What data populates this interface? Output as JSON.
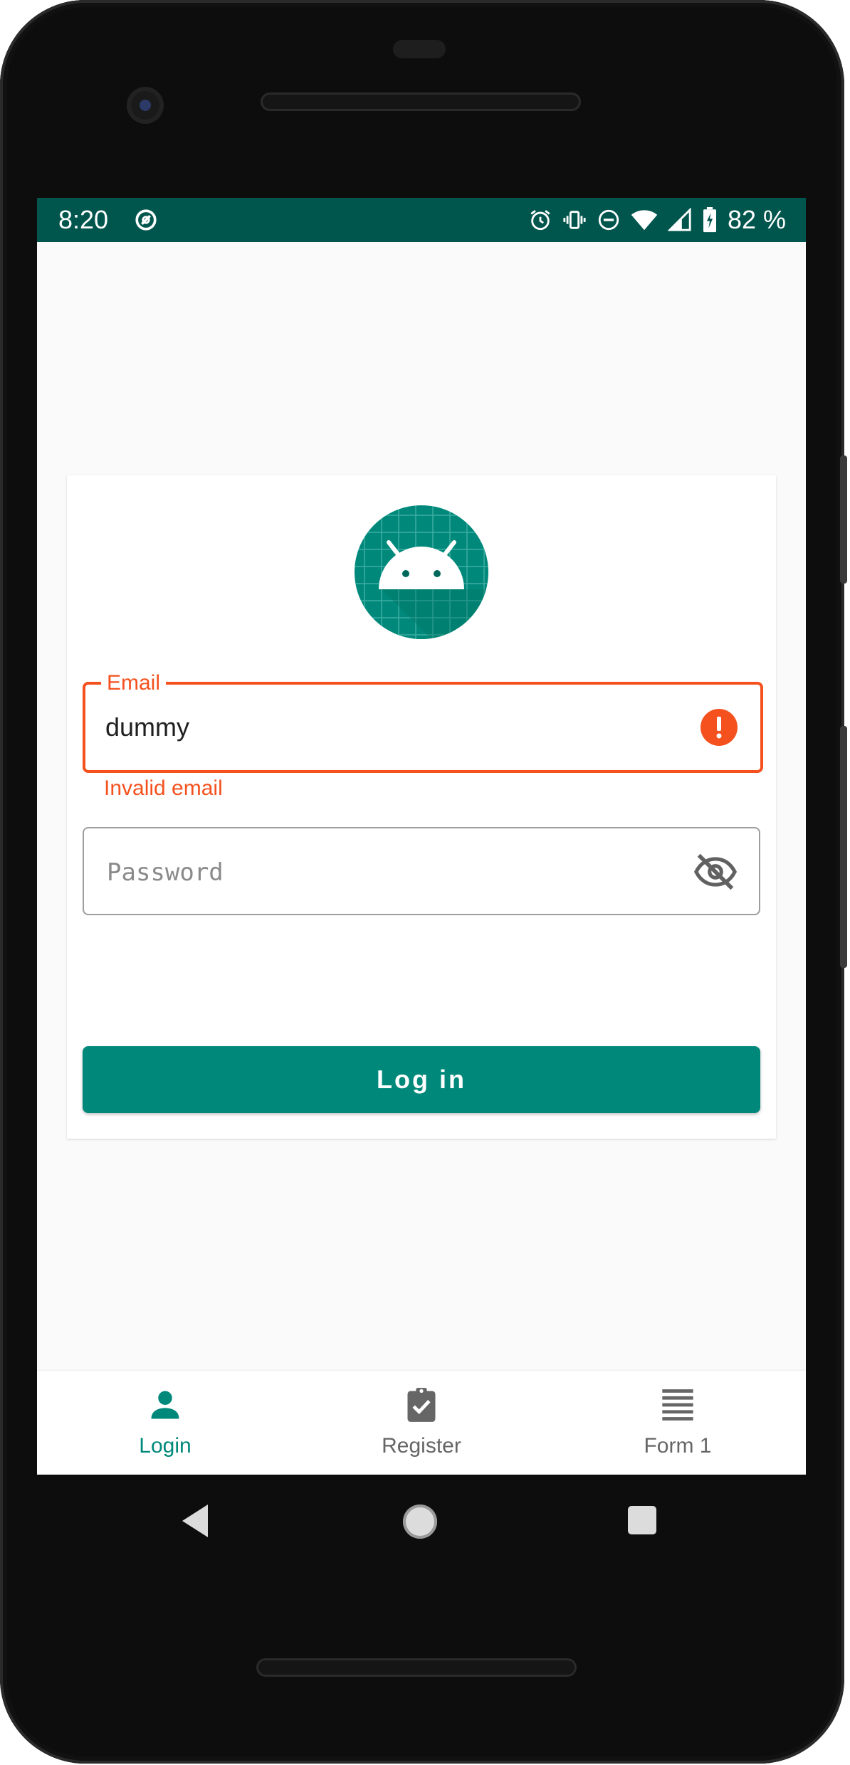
{
  "status_bar": {
    "time": "8:20",
    "battery_percent": "82 %",
    "icons": [
      "do-not-disturb-icon",
      "alarm-icon",
      "vibrate-icon",
      "dnd-icon",
      "wifi-icon",
      "signal-icon",
      "battery-charging-icon"
    ]
  },
  "login": {
    "logo_icon": "android-logo-icon",
    "email": {
      "label": "Email",
      "value": "dummy",
      "error": "Invalid email",
      "error_icon": "error-icon"
    },
    "password": {
      "placeholder": "Password",
      "toggle_icon": "visibility-off-icon"
    },
    "login_button": "Log in"
  },
  "bottom_nav": {
    "items": [
      {
        "label": "Login",
        "icon": "person-icon",
        "active": true
      },
      {
        "label": "Register",
        "icon": "clipboard-check-icon",
        "active": false
      },
      {
        "label": "Form 1",
        "icon": "list-icon",
        "active": false
      }
    ]
  },
  "colors": {
    "status_bar": "#00564d",
    "primary": "#00897b",
    "error": "#f4511e",
    "inactive_nav": "#666666"
  }
}
